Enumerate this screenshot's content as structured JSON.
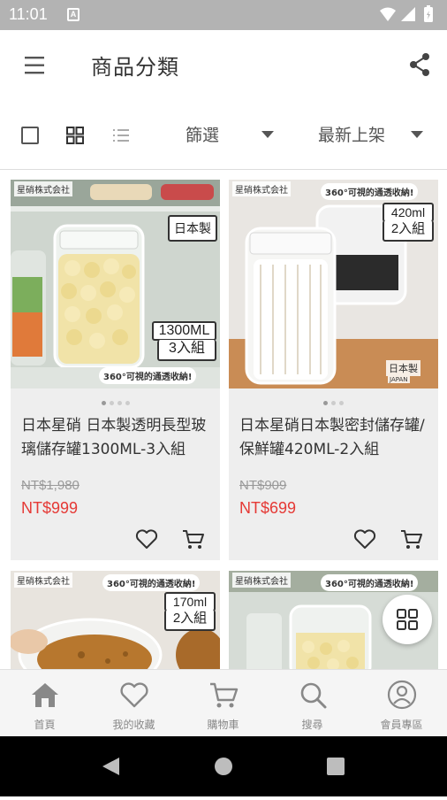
{
  "status_bar": {
    "time": "11:01",
    "badge": "A"
  },
  "app_bar": {
    "title": "商品分類"
  },
  "toolbar": {
    "filter_label": "篩選",
    "sort_label": "最新上架"
  },
  "products": [
    {
      "name": "日本星硝 日本製透明長型玻璃儲存罐1300ML-3入組",
      "old_price": "NT$1,980",
      "price": "NT$999",
      "image": {
        "brand": "星硝株式会社",
        "made_in": "日本製",
        "capacity": "1300ML",
        "count": "3入組",
        "slogan": "360°可視的通透收納!"
      }
    },
    {
      "name": "日本星硝日本製密封儲存罐/保鮮罐420ML-2入組",
      "old_price": "NT$909",
      "price": "NT$699",
      "image": {
        "brand": "星硝株式会社",
        "slogan": "360°可視的通透收納!",
        "capacity": "420ml",
        "count": "2入組",
        "made_in": "日本製",
        "country": "JAPAN"
      }
    },
    {
      "image": {
        "brand": "星硝株式会社",
        "slogan": "360°可視的通透收納!",
        "capacity": "170ml",
        "count": "2入組"
      }
    },
    {
      "image": {
        "brand": "星硝株式会社",
        "slogan": "360°可視的通透收納!"
      }
    }
  ],
  "bottom_nav": [
    {
      "label": "首頁",
      "icon": "home-icon"
    },
    {
      "label": "我的收藏",
      "icon": "heart-icon"
    },
    {
      "label": "購物車",
      "icon": "cart-icon"
    },
    {
      "label": "搜尋",
      "icon": "search-icon"
    },
    {
      "label": "會員專區",
      "icon": "user-icon"
    }
  ],
  "colors": {
    "accent_price": "#e53935",
    "card_bg": "#eeeeee",
    "status_bar": "#b3b3b3"
  }
}
